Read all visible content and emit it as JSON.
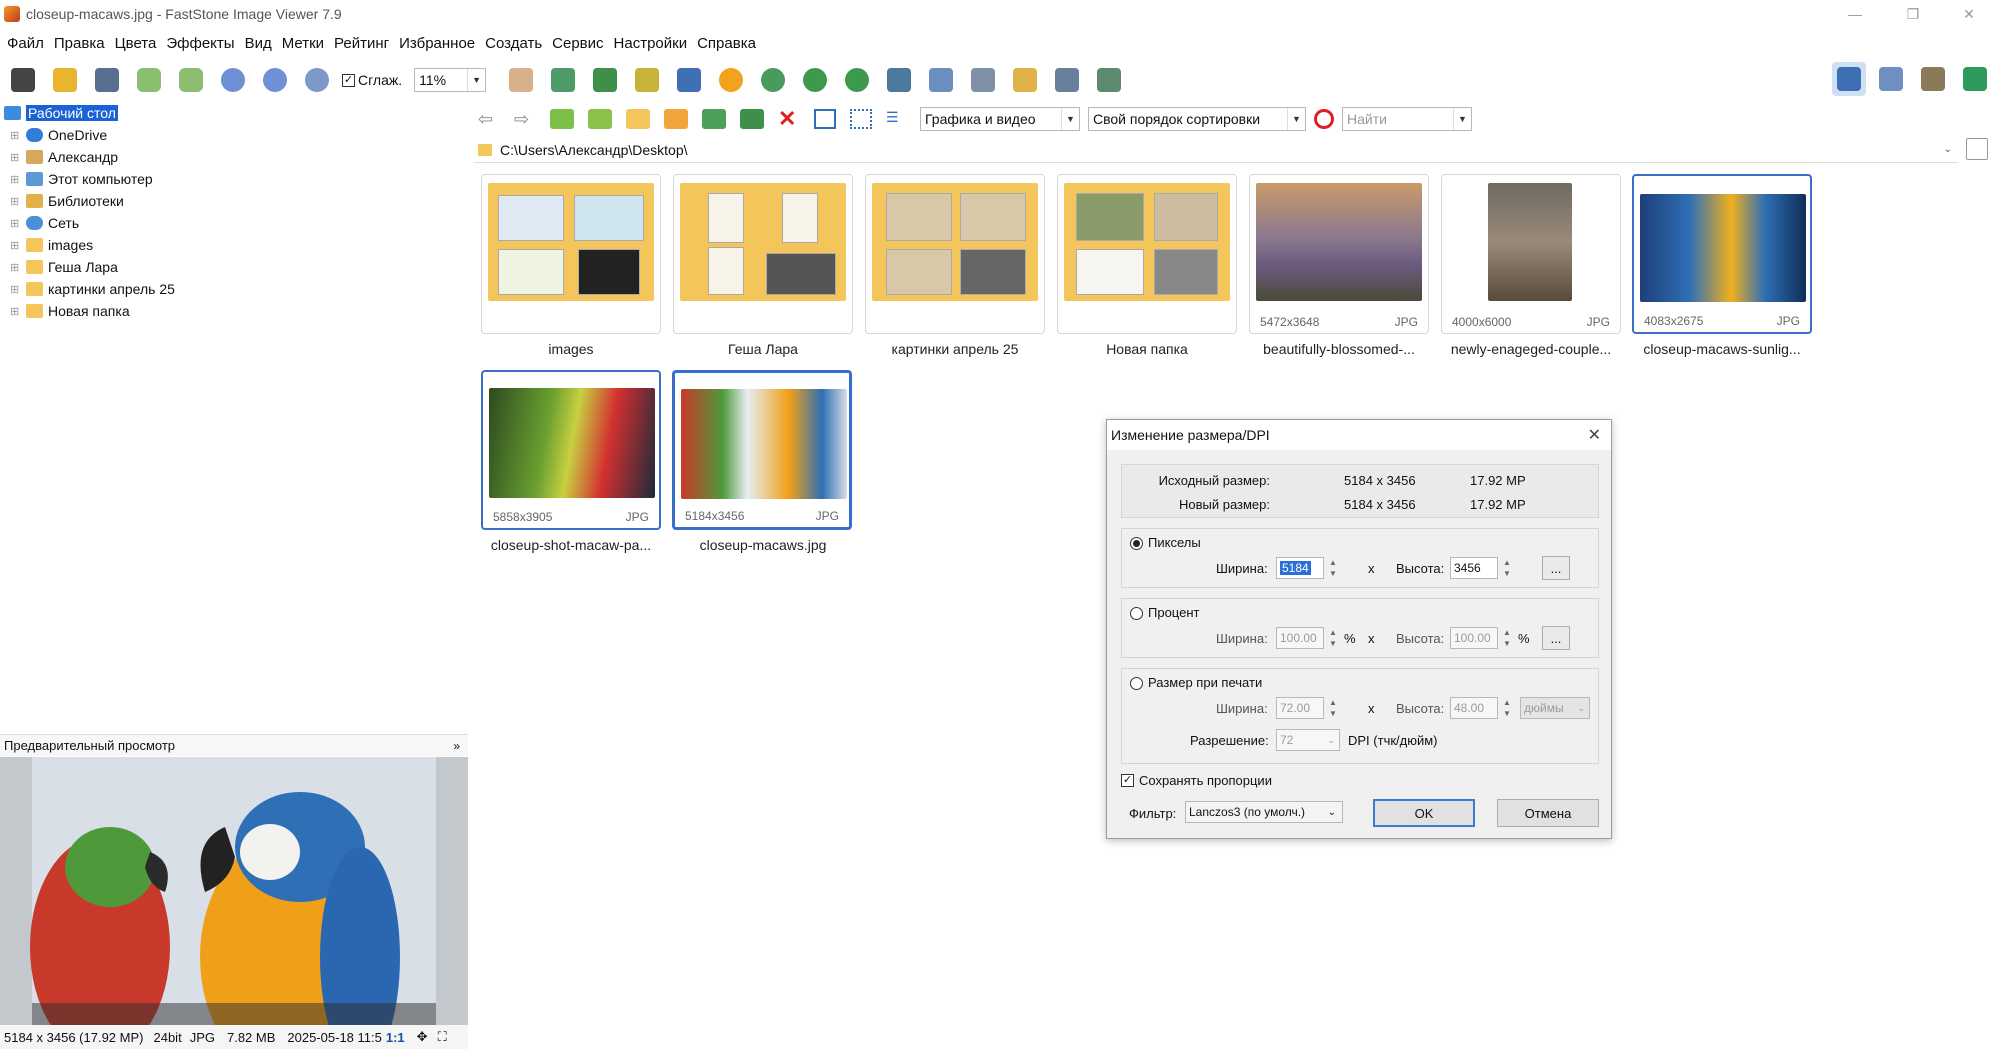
{
  "window": {
    "title": "closeup-macaws.jpg - FastStone Image Viewer 7.9"
  },
  "menu": [
    "Файл",
    "Правка",
    "Цвета",
    "Эффекты",
    "Вид",
    "Метки",
    "Рейтинг",
    "Избранное",
    "Создать",
    "Сервис",
    "Настройки",
    "Справка"
  ],
  "toolbar": {
    "smooth_label": "Сглаж.",
    "zoom_value": "11%"
  },
  "browser_toolbar": {
    "filter_value": "Графика и видео",
    "sort_value": "Свой порядок сортировки",
    "search_placeholder": "Найти"
  },
  "path": "C:\\Users\\Александр\\Desktop\\",
  "tree": [
    "Рабочий стол",
    "OneDrive",
    "Александр",
    "Этот компьютер",
    "Библиотеки",
    "Сеть",
    "images",
    "Геша Лара",
    "картинки апрель 25",
    "Новая папка"
  ],
  "thumbnails": [
    {
      "name": "images",
      "dims": "",
      "ext": ""
    },
    {
      "name": "Геша Лара",
      "dims": "",
      "ext": ""
    },
    {
      "name": "картинки апрель 25",
      "dims": "",
      "ext": ""
    },
    {
      "name": "Новая папка",
      "dims": "",
      "ext": ""
    },
    {
      "name": "beautifully-blossomed-...",
      "dims": "5472x3648",
      "ext": "JPG"
    },
    {
      "name": "newly-enageged-couple...",
      "dims": "4000x6000",
      "ext": "JPG"
    },
    {
      "name": "closeup-macaws-sunlig...",
      "dims": "4083x2675",
      "ext": "JPG"
    },
    {
      "name": "closeup-shot-macaw-pa...",
      "dims": "5858x3905",
      "ext": "JPG"
    },
    {
      "name": "closeup-macaws.jpg",
      "dims": "5184x3456",
      "ext": "JPG"
    }
  ],
  "preview": {
    "header": "Предварительный просмотр"
  },
  "status": {
    "size": "5184 x 3456 (17.92 MP)",
    "bits": "24bit",
    "fmt": "JPG",
    "filesize": "7.82 MB",
    "date": "2025-05-18 11:5",
    "ratio": "1:1"
  },
  "dialog": {
    "title": "Изменение размера/DPI",
    "orig_label": "Исходный размер:",
    "orig_dims": "5184 x 3456",
    "orig_mp": "17.92 MP",
    "new_label": "Новый размер:",
    "new_dims": "5184 x 3456",
    "new_mp": "17.92 MP",
    "pixels_label": "Пикселы",
    "width_label": "Ширина:",
    "height_label": "Высота:",
    "px_width": "5184",
    "px_height": "3456",
    "x": "x",
    "dots": "...",
    "percent_label": "Процент",
    "pct_width": "100.00",
    "pct_height": "100.00",
    "pct_sign": "%",
    "print_label": "Размер при печати",
    "pr_width": "72.00",
    "pr_height": "48.00",
    "unit": "дюймы",
    "res_label": "Разрешение:",
    "res_value": "72",
    "dpi_label": "DPI (тчк/дюйм)",
    "keep_label": "Сохранять пропорции",
    "filter_label": "Фильтр:",
    "filter_value": "Lanczos3 (по умолч.)",
    "ok": "OK",
    "cancel": "Отмена"
  }
}
